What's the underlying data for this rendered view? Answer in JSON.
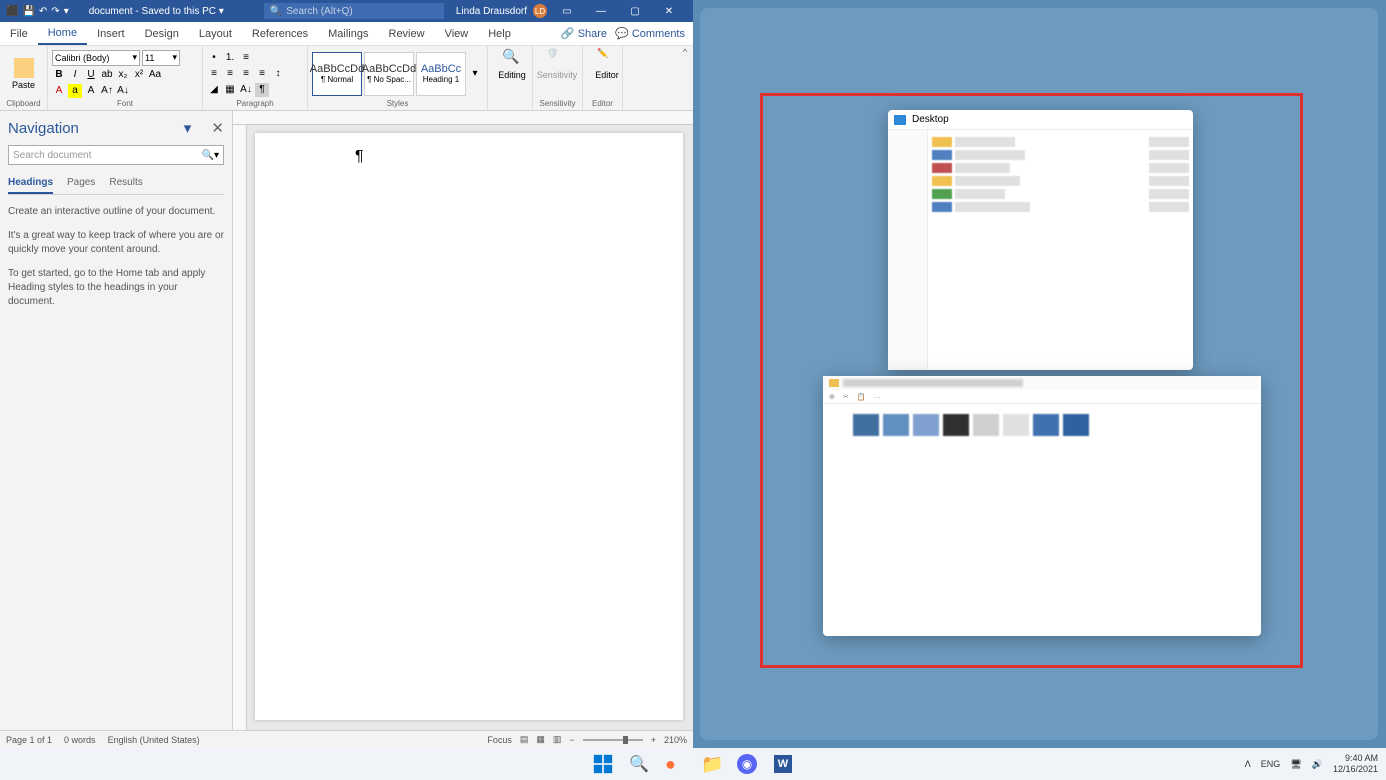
{
  "titlebar": {
    "doc_name": "document - Saved to this PC ▾",
    "search_placeholder": "Search (Alt+Q)",
    "user_name": "Linda Drausdorf",
    "user_initials": "LD"
  },
  "ribbon_tabs": {
    "file": "File",
    "home": "Home",
    "insert": "Insert",
    "design": "Design",
    "layout": "Layout",
    "references": "References",
    "mailings": "Mailings",
    "review": "Review",
    "view": "View",
    "help": "Help",
    "share": "Share",
    "comments": "Comments"
  },
  "ribbon": {
    "clipboard": "Clipboard",
    "paste": "Paste",
    "font_group": "Font",
    "font_name": "Calibri (Body)",
    "font_size": "11",
    "paragraph": "Paragraph",
    "styles": "Styles",
    "style1_sample": "AaBbCcDd",
    "style1_name": "¶ Normal",
    "style2_sample": "AaBbCcDd",
    "style2_name": "¶ No Spac...",
    "style3_sample": "AaBbCc",
    "style3_name": "Heading 1",
    "editing": "Editing",
    "sensitivity": "Sensitivity",
    "editor": "Editor"
  },
  "nav": {
    "title": "Navigation",
    "search_placeholder": "Search document",
    "tab_headings": "Headings",
    "tab_pages": "Pages",
    "tab_results": "Results",
    "text1": "Create an interactive outline of your document.",
    "text2": "It's a great way to keep track of where you are or quickly move your content around.",
    "text3": "To get started, go to the Home tab and apply Heading styles to the headings in your document."
  },
  "status": {
    "page": "Page 1 of 1",
    "words": "0 words",
    "lang": "English (United States)",
    "focus": "Focus",
    "zoom": "210%"
  },
  "snap": {
    "window1_title": "Desktop"
  },
  "systray": {
    "lang": "ENG",
    "time": "9:40 AM",
    "date": "12/16/2021"
  }
}
